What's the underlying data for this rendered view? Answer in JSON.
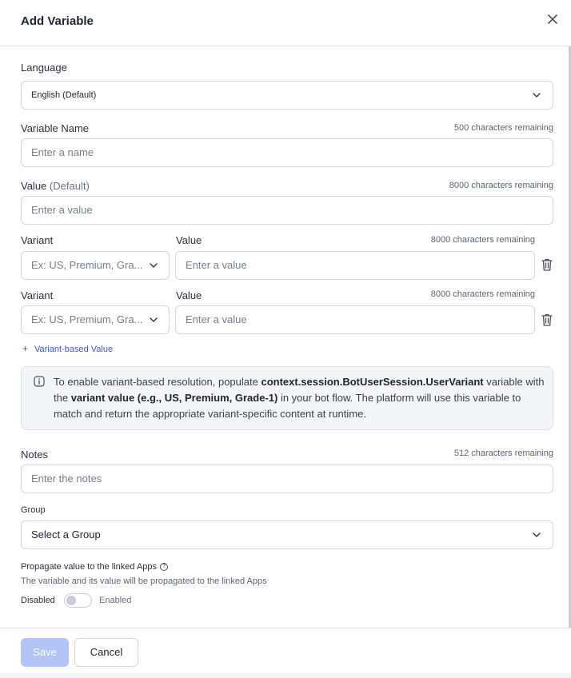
{
  "dialog": {
    "title": "Add Variable"
  },
  "language": {
    "label": "Language",
    "value": "English (Default)"
  },
  "variable_name": {
    "label": "Variable Name",
    "remaining": "500 characters remaining",
    "placeholder": "Enter a name"
  },
  "default_value": {
    "label": "Value",
    "label_suffix": "(Default)",
    "remaining": "8000 characters remaining",
    "placeholder": "Enter a value"
  },
  "variants": [
    {
      "variant_label": "Variant",
      "value_label": "Value",
      "remaining": "8000 characters remaining",
      "variant_placeholder": "Ex: US, Premium, Gra...",
      "value_placeholder": "Enter a value"
    },
    {
      "variant_label": "Variant",
      "value_label": "Value",
      "remaining": "8000 characters remaining",
      "variant_placeholder": "Ex: US, Premium, Gra...",
      "value_placeholder": "Enter a value"
    }
  ],
  "add_variant": {
    "icon": "+",
    "label": "Variant-based Value"
  },
  "info": {
    "t1": "To enable variant-based resolution, populate ",
    "b1": "context.session.BotUserSession.UserVariant",
    "t2": " variable with the ",
    "b2": "variant value (e.g., US, Premium, Grade-1)",
    "t3": " in your bot flow. The platform will use this variable to match and return the appropriate variant-specific content at runtime."
  },
  "notes": {
    "label": "Notes",
    "remaining": "512 characters remaining",
    "placeholder": "Enter the notes"
  },
  "group": {
    "label": "Group",
    "value": "Select a Group"
  },
  "propagate": {
    "label": "Propagate value to the linked Apps",
    "help_icon": "?",
    "description": "The variable and its value will be propagated to the linked Apps",
    "off_label": "Disabled",
    "on_label": "Enabled",
    "enabled": false
  },
  "footer": {
    "save_label": "Save",
    "cancel_label": "Cancel"
  },
  "colors": {
    "accent": "#3b5bdb",
    "save_disabled": "#b3c3f5",
    "border": "#d3d6dd"
  }
}
